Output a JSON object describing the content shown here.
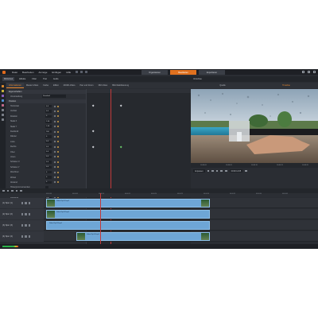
{
  "window": {
    "menu": [
      "Datei",
      "Bearbeiten",
      "Anzeige",
      "Einfügen",
      "Hilfe"
    ],
    "modes": [
      "Organisieren",
      "Bearbeiten",
      "Exportieren"
    ],
    "active_mode": "Bearbeiten"
  },
  "library_bar": {
    "items": [
      "Bibliothek",
      "Effekte",
      "Filter",
      "Titel",
      "Audio"
    ]
  },
  "editor_tabs": [
    "Informationen",
    "Master-Video",
    "Farbe",
    "Effekt",
    "2D/3D-Video",
    "Pan und Zoom",
    "360-Video",
    "Bild-Stabilisierung"
  ],
  "active_editor_tab": "Informationen",
  "properties": {
    "section_main": "Eigenschaften",
    "preset_label": "Voreinstellung",
    "preset_value": "Standard",
    "section_position": "Position",
    "rows": [
      {
        "label": "Horizontal",
        "value": "0.0"
      },
      {
        "label": "Vertikal",
        "value": "0.0"
      },
      {
        "label": "Rotation",
        "value": "0"
      },
      {
        "label": "Skala X",
        "value": "1.00"
      },
      {
        "label": "Skala Y",
        "value": "1.00"
      },
      {
        "label": "Deckkraft",
        "value": "100"
      },
      {
        "label": "Ränder",
        "value": "0"
      },
      {
        "label": "Links",
        "value": "0.0"
      },
      {
        "label": "Rechts",
        "value": "0.0"
      },
      {
        "label": "Oben",
        "value": "0.0"
      },
      {
        "label": "Unten",
        "value": "0.0"
      },
      {
        "label": "Schatten X",
        "value": "0.0"
      },
      {
        "label": "Schatten Y",
        "value": "0.0"
      },
      {
        "label": "Weichheit",
        "value": "0"
      },
      {
        "label": "Winkel",
        "value": "0"
      },
      {
        "label": "Abstand",
        "value": "0"
      },
      {
        "label": "Hintergrund verwenden",
        "value": ""
      },
      {
        "label": "Farbe",
        "value": ""
      },
      {
        "label": "Deckkraft",
        "value": "100"
      }
    ]
  },
  "preview": {
    "header": "Vorschau",
    "tabs": [
      "Quelle",
      "Timeline"
    ],
    "active_tab": "Timeline",
    "ruler": [
      "00:00:00",
      "00:00:05",
      "00:00:10",
      "00:00:15",
      "00:00:20"
    ],
    "timecode": "00:00:14:05",
    "zoom": "Anpassen"
  },
  "timeline": {
    "ruler": [
      "00:00:00",
      "00:00:05",
      "00:00:10",
      "00:00:15",
      "00:00:20",
      "00:00:25",
      "00:00:30",
      "00:00:35",
      "00:00:40",
      "00:00:45"
    ],
    "tracks": [
      {
        "name": "(1) Spur (1)",
        "clip": "Video-Clip 001.mp4"
      },
      {
        "name": "(2) Spur (2)",
        "clip": "Video-Clip 002.mp4"
      },
      {
        "name": "(3) Spur (3)",
        "clip": "Video-Clip 003.mp4"
      },
      {
        "name": "(4) Spur (4)",
        "clip": "Video-Clip 004.mp4"
      }
    ]
  },
  "colors": {
    "accent": "#e0711f",
    "clip": "#6ea6d6",
    "playhead": "#c23a3a",
    "background": "#2a2d33"
  }
}
